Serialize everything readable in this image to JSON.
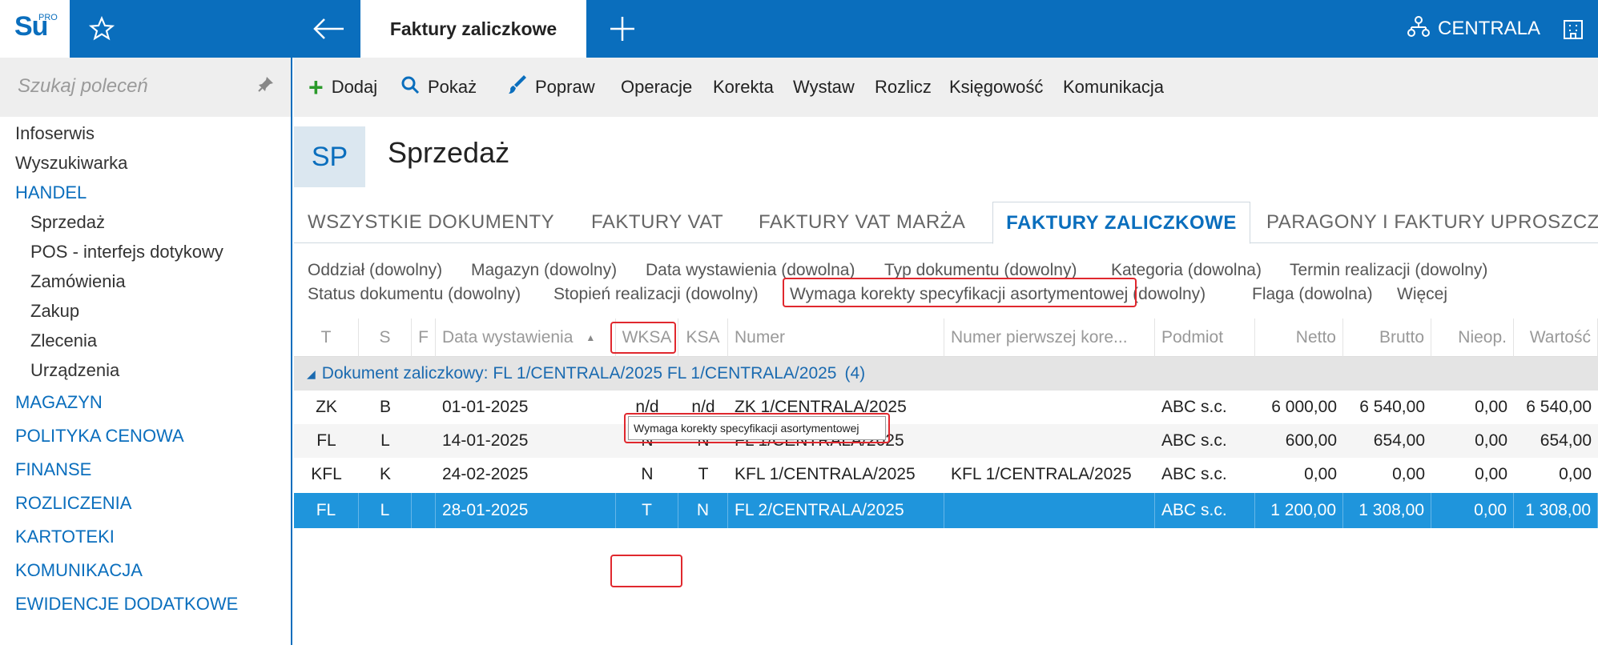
{
  "app": {
    "logo_text": "Su",
    "logo_sup": "PRO",
    "current_tab": "Faktury zaliczkowe",
    "company": "CENTRALA",
    "company_icon": "org-chart-icon",
    "accent": "#0a6ebd"
  },
  "sidebar": {
    "search_placeholder": "Szukaj poleceń",
    "items": [
      {
        "label": "Infoserwis",
        "type": "item"
      },
      {
        "label": "Wyszukiwarka",
        "type": "item"
      },
      {
        "label": "HANDEL",
        "type": "section"
      },
      {
        "label": "Sprzedaż",
        "type": "sub"
      },
      {
        "label": "POS - interfejs dotykowy",
        "type": "sub"
      },
      {
        "label": "Zamówienia",
        "type": "sub"
      },
      {
        "label": "Zakup",
        "type": "sub"
      },
      {
        "label": "Zlecenia",
        "type": "sub"
      },
      {
        "label": "Urządzenia",
        "type": "sub"
      },
      {
        "label": "MAGAZYN",
        "type": "section"
      },
      {
        "label": "POLITYKA CENOWA",
        "type": "section"
      },
      {
        "label": "FINANSE",
        "type": "section"
      },
      {
        "label": "ROZLICZENIA",
        "type": "section"
      },
      {
        "label": "KARTOTEKI",
        "type": "section"
      },
      {
        "label": "KOMUNIKACJA",
        "type": "section"
      },
      {
        "label": "EWIDENCJE DODATKOWE",
        "type": "section"
      }
    ]
  },
  "toolbar": {
    "add": "Dodaj",
    "show": "Pokaż",
    "edit": "Popraw",
    "operations": "Operacje",
    "correction": "Korekta",
    "issue": "Wystaw",
    "settle": "Rozlicz",
    "accounting": "Księgowość",
    "communication": "Komunikacja"
  },
  "header": {
    "badge": "SP",
    "title": "Sprzedaż"
  },
  "tabs": [
    "WSZYSTKIE DOKUMENTY",
    "FAKTURY VAT",
    "FAKTURY VAT MARŻA",
    "FAKTURY ZALICZKOWE",
    "PARAGONY I FAKTURY UPROSZCZO"
  ],
  "filters": {
    "row1": [
      "Oddział (dowolny)",
      "Magazyn (dowolny)",
      "Data wystawienia (dowolna)",
      "Typ dokumentu (dowolny)",
      "Kategoria (dowolna)",
      "Termin realizacji (dowolny)"
    ],
    "row2": [
      "Status dokumentu (dowolny)",
      "Stopień realizacji (dowolny)",
      "Wymaga korekty specyfikacji asortymentowej (dowolny)",
      "Flaga (dowolna)",
      "Więcej"
    ]
  },
  "grid": {
    "columns": [
      "T",
      "S",
      "F",
      "Data wystawienia",
      "WKSA",
      "KSA",
      "Numer",
      "Numer pierwszej kore...",
      "Podmiot",
      "Netto",
      "Brutto",
      "Nieop.",
      "Wartość"
    ],
    "group_label": "Dokument zaliczkowy: FL 1/CENTRALA/2025 FL 1/CENTRALA/2025",
    "group_count": "(4)",
    "rows": [
      [
        "ZK",
        "B",
        "",
        "01-01-2025",
        "n/d",
        "n/d",
        "ZK 1/CENTRALA/2025",
        "",
        "ABC s.c.",
        "6 000,00",
        "6 540,00",
        "0,00",
        "6 540,00"
      ],
      [
        "FL",
        "L",
        "",
        "14-01-2025",
        "N",
        "N",
        "FL 1/CENTRALA/2025",
        "",
        "ABC s.c.",
        "600,00",
        "654,00",
        "0,00",
        "654,00"
      ],
      [
        "KFL",
        "K",
        "",
        "24-02-2025",
        "N",
        "T",
        "KFL 1/CENTRALA/2025",
        "KFL 1/CENTRALA/2025",
        "ABC s.c.",
        "0,00",
        "0,00",
        "0,00",
        "0,00"
      ],
      [
        "FL",
        "L",
        "",
        "28-01-2025",
        "T",
        "N",
        "FL 2/CENTRALA/2025",
        "",
        "ABC s.c.",
        "1 200,00",
        "1 308,00",
        "0,00",
        "1 308,00"
      ]
    ],
    "tooltip": "Wymaga korekty specyfikacji asortymentowej"
  }
}
